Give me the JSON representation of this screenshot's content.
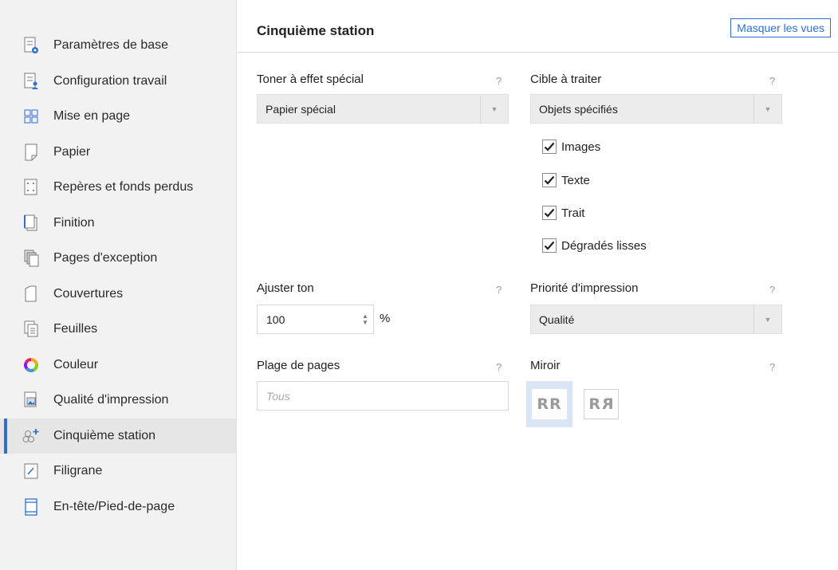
{
  "sidebar": {
    "items": [
      {
        "label": "Paramètres de base",
        "icon": "settings-doc-icon"
      },
      {
        "label": "Configuration travail",
        "icon": "job-config-icon"
      },
      {
        "label": "Mise en page",
        "icon": "layout-grid-icon"
      },
      {
        "label": "Papier",
        "icon": "paper-icon"
      },
      {
        "label": "Repères et fonds perdus",
        "icon": "crop-marks-icon"
      },
      {
        "label": "Finition",
        "icon": "finishing-icon"
      },
      {
        "label": "Pages d'exception",
        "icon": "exception-pages-icon"
      },
      {
        "label": "Couvertures",
        "icon": "covers-icon"
      },
      {
        "label": "Feuilles",
        "icon": "sheets-icon"
      },
      {
        "label": "Couleur",
        "icon": "color-wheel-icon"
      },
      {
        "label": "Qualité d'impression",
        "icon": "print-quality-icon"
      },
      {
        "label": "Cinquième station",
        "icon": "fifth-station-icon"
      },
      {
        "label": "Filigrane",
        "icon": "watermark-icon"
      },
      {
        "label": "En-tête/Pied-de-page",
        "icon": "header-footer-icon"
      }
    ],
    "active_index": 11
  },
  "header": {
    "title": "Cinquième station",
    "hide_views_label": "Masquer les vues"
  },
  "help_mark": "?",
  "toner": {
    "label": "Toner à effet spécial",
    "value": "Papier spécial"
  },
  "target": {
    "label": "Cible à traiter",
    "value": "Objets spécifiés",
    "options": [
      {
        "label": "Images",
        "checked": true
      },
      {
        "label": "Texte",
        "checked": true
      },
      {
        "label": "Trait",
        "checked": true
      },
      {
        "label": "Dégradés lisses",
        "checked": true
      }
    ]
  },
  "tone": {
    "label": "Ajuster ton",
    "value": "100",
    "unit": "%"
  },
  "priority": {
    "label": "Priorité d'impression",
    "value": "Qualité"
  },
  "page_range": {
    "label": "Plage de pages",
    "placeholder": "Tous"
  },
  "mirror": {
    "label": "Miroir",
    "normal_text": "RR",
    "mirrored_text_left": "R",
    "mirrored_text_right": "R",
    "selected": "normal"
  },
  "colors": {
    "accent": "#2f6fd0",
    "sidebar_bg": "#f2f2f2",
    "selected_bg": "#dbe6f5"
  }
}
